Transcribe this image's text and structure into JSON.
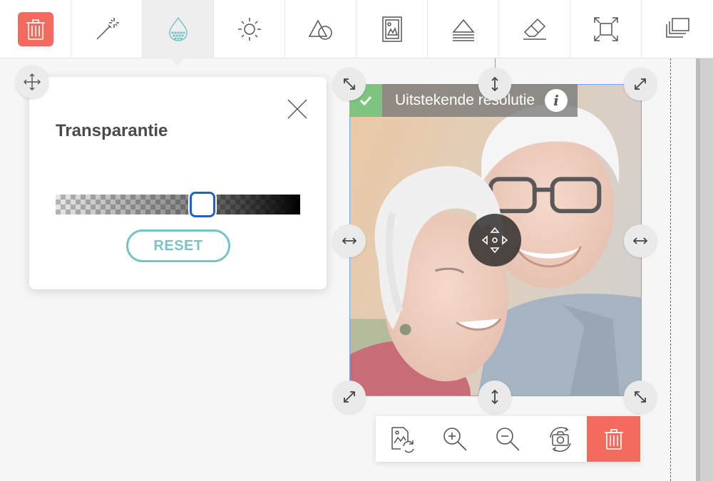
{
  "toolbar": {
    "tools": [
      {
        "name": "delete",
        "icon": "trash-icon"
      },
      {
        "name": "magic-wand",
        "icon": "magic-wand-icon"
      },
      {
        "name": "transparency",
        "icon": "droplet-icon",
        "active": true
      },
      {
        "name": "brightness",
        "icon": "sun-icon"
      },
      {
        "name": "shapes",
        "icon": "shapes-icon"
      },
      {
        "name": "frame",
        "icon": "frame-icon"
      },
      {
        "name": "layers-align",
        "icon": "triangle-layers-icon"
      },
      {
        "name": "eraser",
        "icon": "eraser-icon"
      },
      {
        "name": "fit",
        "icon": "fullscreen-icon"
      },
      {
        "name": "arrange",
        "icon": "arrange-icon"
      }
    ],
    "accent_color": "#f36b5e",
    "active_icon_color": "#79c3c6"
  },
  "panel": {
    "title": "Transparantie",
    "slider_value": 0.5,
    "reset_label": "RESET",
    "close_icon": "close-icon",
    "move_icon": "move-arrows-icon"
  },
  "photo": {
    "resolution_label": "Uitstekende resolutie",
    "resolution_status": "check-icon",
    "info_label": "i",
    "border_color": "#7aa6e8"
  },
  "bottom_bar": {
    "buttons": [
      {
        "name": "replace-image",
        "icon": "replace-image-icon"
      },
      {
        "name": "zoom-in",
        "icon": "zoom-in-icon"
      },
      {
        "name": "zoom-out",
        "icon": "zoom-out-icon"
      },
      {
        "name": "rotate",
        "icon": "rotate-camera-icon"
      },
      {
        "name": "delete",
        "icon": "trash-icon"
      }
    ]
  }
}
